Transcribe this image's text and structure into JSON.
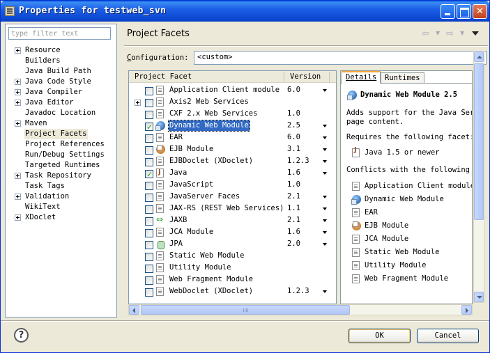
{
  "window": {
    "title": "Properties for testweb_svn"
  },
  "left": {
    "filter_placeholder": "type filter text",
    "items": [
      {
        "label": "Resource",
        "expandable": true
      },
      {
        "label": "Builders",
        "expandable": false
      },
      {
        "label": "Java Build Path",
        "expandable": false
      },
      {
        "label": "Java Code Style",
        "expandable": true
      },
      {
        "label": "Java Compiler",
        "expandable": true
      },
      {
        "label": "Java Editor",
        "expandable": true
      },
      {
        "label": "Javadoc Location",
        "expandable": false
      },
      {
        "label": "Maven",
        "expandable": true
      },
      {
        "label": "Project Facets",
        "expandable": false,
        "selected": true
      },
      {
        "label": "Project References",
        "expandable": false
      },
      {
        "label": "Run/Debug Settings",
        "expandable": false
      },
      {
        "label": "Targeted Runtimes",
        "expandable": false
      },
      {
        "label": "Task Repository",
        "expandable": true
      },
      {
        "label": "Task Tags",
        "expandable": false
      },
      {
        "label": "Validation",
        "expandable": true
      },
      {
        "label": "WikiText",
        "expandable": false
      },
      {
        "label": "XDoclet",
        "expandable": true
      }
    ]
  },
  "header": {
    "title": "Project Facets"
  },
  "config": {
    "label": "onfiguration:",
    "label_mnemonic": "C",
    "value": "<custom>"
  },
  "facets": {
    "col_facet": "Project Facet",
    "col_version": "Version",
    "rows": [
      {
        "name": "Application Client module",
        "version": "6.0",
        "checked": false,
        "icon": "doc-icon",
        "dropdown": true
      },
      {
        "name": "Axis2 Web Services",
        "version": "",
        "checked": false,
        "icon": "doc-icon",
        "dropdown": false,
        "expandable": true
      },
      {
        "name": "CXF 2.x Web Services",
        "version": "1.0",
        "checked": false,
        "icon": "doc-icon",
        "dropdown": false
      },
      {
        "name": "Dynamic Web Module",
        "version": "2.5",
        "checked": true,
        "icon": "globe-icon",
        "dropdown": true,
        "selected": true
      },
      {
        "name": "EAR",
        "version": "6.0",
        "checked": false,
        "icon": "doc-icon",
        "dropdown": true
      },
      {
        "name": "EJB Module",
        "version": "3.1",
        "checked": false,
        "icon": "bean-icon",
        "dropdown": true
      },
      {
        "name": "EJBDoclet (XDoclet)",
        "version": "1.2.3",
        "checked": false,
        "icon": "doc-icon",
        "dropdown": true
      },
      {
        "name": "Java",
        "version": "1.6",
        "checked": true,
        "icon": "java-icon",
        "dropdown": true
      },
      {
        "name": "JavaScript",
        "version": "1.0",
        "checked": false,
        "icon": "doc-icon",
        "dropdown": false
      },
      {
        "name": "JavaServer Faces",
        "version": "2.1",
        "checked": false,
        "icon": "doc-icon",
        "dropdown": true
      },
      {
        "name": "JAX-RS (REST Web Services)",
        "version": "1.1",
        "checked": false,
        "icon": "doc-icon",
        "dropdown": true
      },
      {
        "name": "JAXB",
        "version": "2.1",
        "checked": false,
        "icon": "jaxb-icon",
        "dropdown": true
      },
      {
        "name": "JCA Module",
        "version": "1.6",
        "checked": false,
        "icon": "doc-icon",
        "dropdown": true
      },
      {
        "name": "JPA",
        "version": "2.0",
        "checked": false,
        "icon": "jpa-icon",
        "dropdown": true
      },
      {
        "name": "Static Web Module",
        "version": "",
        "checked": false,
        "icon": "doc-icon",
        "dropdown": false
      },
      {
        "name": "Utility Module",
        "version": "",
        "checked": false,
        "icon": "doc-icon",
        "dropdown": false
      },
      {
        "name": "Web Fragment Module",
        "version": "",
        "checked": false,
        "icon": "doc-icon",
        "dropdown": false
      },
      {
        "name": "WebDoclet (XDoclet)",
        "version": "1.2.3",
        "checked": false,
        "icon": "doc-icon",
        "dropdown": true
      }
    ]
  },
  "details": {
    "tab_details": "Details",
    "tab_runtimes": "Runtimes",
    "title": "Dynamic Web Module 2.5",
    "desc_1": "Adds support for the Java Servl",
    "desc_2": "page content.",
    "requires": "Requires the following facet:",
    "requires_item": "Java 1.5 or newer",
    "conflicts": "Conflicts with the following f",
    "conflicts_items": [
      {
        "label": "Application Client module",
        "icon": "doc-icon"
      },
      {
        "label": "Dynamic Web Module",
        "icon": "globe-icon"
      },
      {
        "label": "EAR",
        "icon": "doc-icon"
      },
      {
        "label": "EJB Module",
        "icon": "bean-icon"
      },
      {
        "label": "JCA Module",
        "icon": "doc-icon"
      },
      {
        "label": "Static Web Module",
        "icon": "doc-icon"
      },
      {
        "label": "Utility Module",
        "icon": "doc-icon"
      },
      {
        "label": "Web Fragment Module",
        "icon": "doc-icon"
      }
    ]
  },
  "buttons": {
    "ok": "OK",
    "cancel": "Cancel",
    "help": "?"
  }
}
